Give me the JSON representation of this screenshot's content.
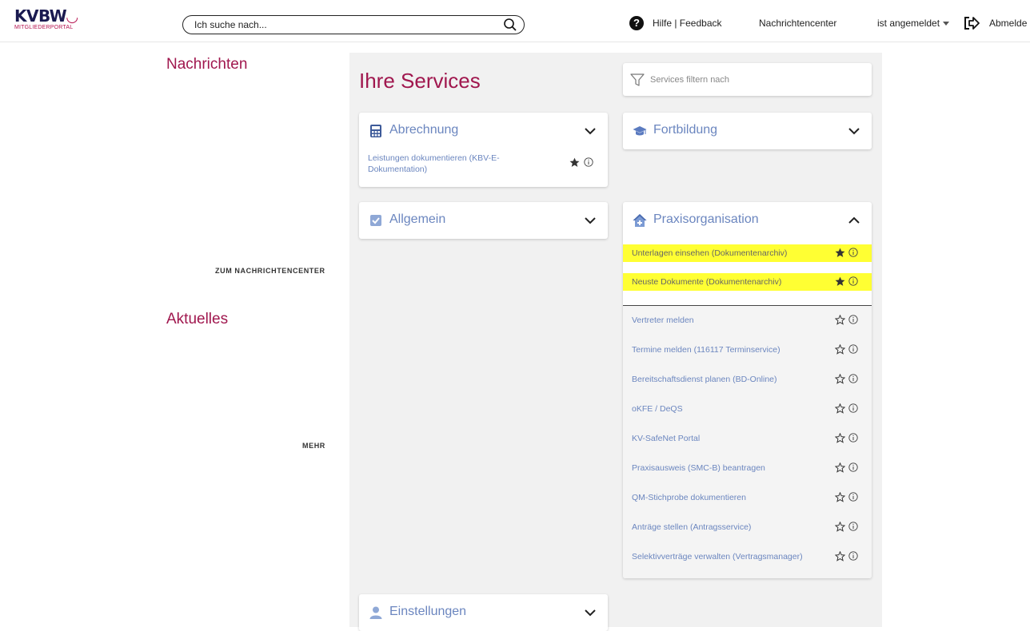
{
  "header": {
    "logo_name": "KVBW",
    "logo_sub": "MITGLIEDERPORTAL",
    "search_placeholder": "Ich suche nach...",
    "help_label": "Hilfe | Feedback",
    "messages_label": "Nachrichtencenter",
    "user_status": "ist angemeldet",
    "logout_label": "Abmelde"
  },
  "left": {
    "news_title": "Nachrichten",
    "news_link": "ZUM NACHRICHTENCENTER",
    "current_title": "Aktuelles",
    "current_link": "MEHR"
  },
  "services": {
    "title": "Ihre Services",
    "filter_placeholder": "Services filtern nach",
    "abrechnung": {
      "title": "Abrechnung",
      "icon": "calculator-icon",
      "item_line1": "Leistungen dokumentieren (KBV-E-",
      "item_line2": "Dokumentation)"
    },
    "allgemein": {
      "title": "Allgemein",
      "icon": "checkbox-icon"
    },
    "fortbildung": {
      "title": "Fortbildung",
      "icon": "graduation-cap-icon"
    },
    "einstellungen": {
      "title": "Einstellungen",
      "icon": "user-icon"
    },
    "praxis": {
      "title": "Praxisorganisation",
      "icon": "house-plus-icon",
      "favorites": [
        "Unterlagen einsehen (Dokumentenarchiv)",
        "Neuste Dokumente (Dokumentenarchiv)"
      ],
      "items": [
        "Vertreter melden",
        "Termine melden (116117 Terminservice)",
        "Bereitschaftsdienst planen (BD-Online)",
        "oKFE / DeQS",
        "KV-SafeNet Portal",
        "Praxisausweis (SMC-B) beantragen",
        "QM-Stichprobe dokumentieren",
        "Anträge stellen (Antragsservice)",
        "Selektivverträge verwalten (Vertragsmanager)"
      ]
    }
  },
  "colors": {
    "brand": "#a0174e",
    "link": "#6b86bf",
    "highlight": "#ffff33",
    "panel": "#f1f1f1"
  }
}
